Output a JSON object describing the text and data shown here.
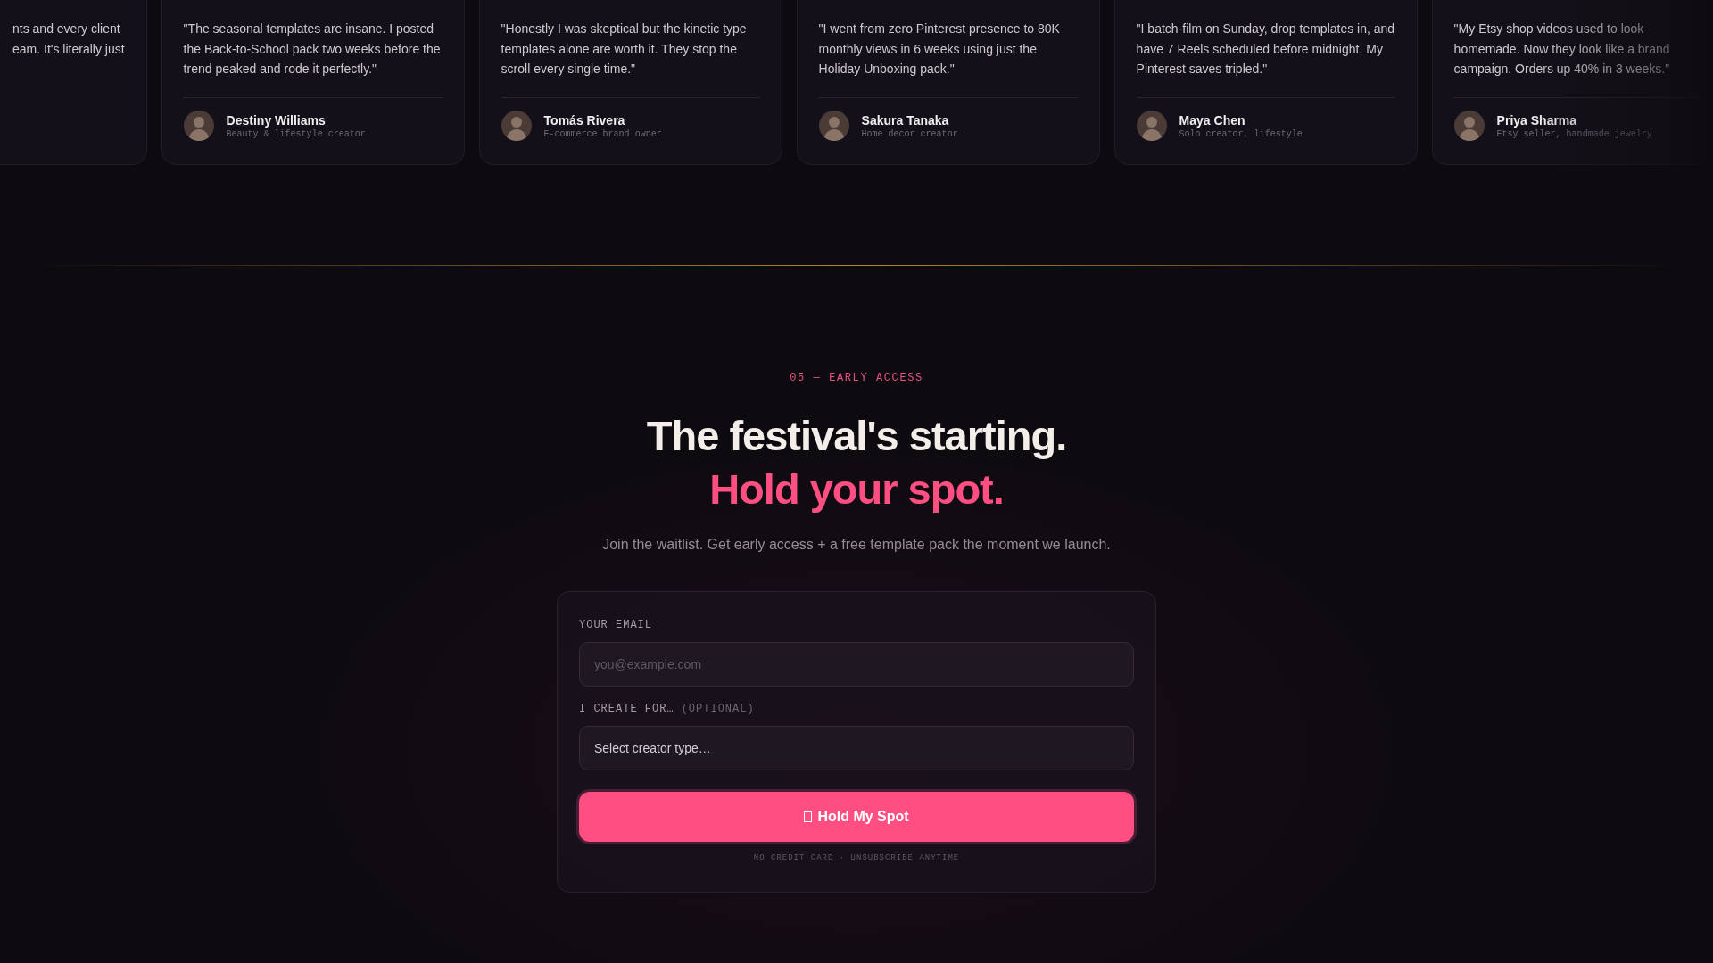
{
  "testimonials_partial": {
    "quote_lines": [
      "nts and every client",
      "eam. It's literally just"
    ]
  },
  "testimonials": [
    {
      "quote": "\"The seasonal templates are insane. I posted the Back-to-School pack two weeks before the trend peaked and rode it perfectly.\"",
      "name": "Destiny Williams",
      "role": "Beauty & lifestyle creator"
    },
    {
      "quote": "\"Honestly I was skeptical but the kinetic type templates alone are worth it. They stop the scroll every single time.\"",
      "name": "Tomás Rivera",
      "role": "E-commerce brand owner"
    },
    {
      "quote": "\"I went from zero Pinterest presence to 80K monthly views in 6 weeks using just the Holiday Unboxing pack.\"",
      "name": "Sakura Tanaka",
      "role": "Home decor creator"
    },
    {
      "quote": "\"I batch-film on Sunday, drop templates in, and have 7 Reels scheduled before midnight. My Pinterest saves tripled.\"",
      "name": "Maya Chen",
      "role": "Solo creator, lifestyle"
    },
    {
      "quote": "\"My Etsy shop videos used to look homemade. Now they look like a brand campaign. Orders up 40% in 3 weeks.\"",
      "name": "Priya Sharma",
      "role": "Etsy seller, handmade jewelry"
    }
  ],
  "early_access": {
    "eyebrow": "05 — EARLY ACCESS",
    "headline": "The festival's starting.",
    "headline_accent": "Hold your spot.",
    "subtitle": "Join the waitlist. Get early access + a free template pack the moment we launch.",
    "form": {
      "email_label": "YOUR EMAIL",
      "email_placeholder": "you@example.com",
      "creator_label": "I CREATE FOR…",
      "creator_label_note": "(OPTIONAL)",
      "creator_select": "Select creator type…",
      "button": "Hold My Spot",
      "footnote": "NO CREDIT CARD · UNSUBSCRIBE ANYTIME"
    }
  }
}
